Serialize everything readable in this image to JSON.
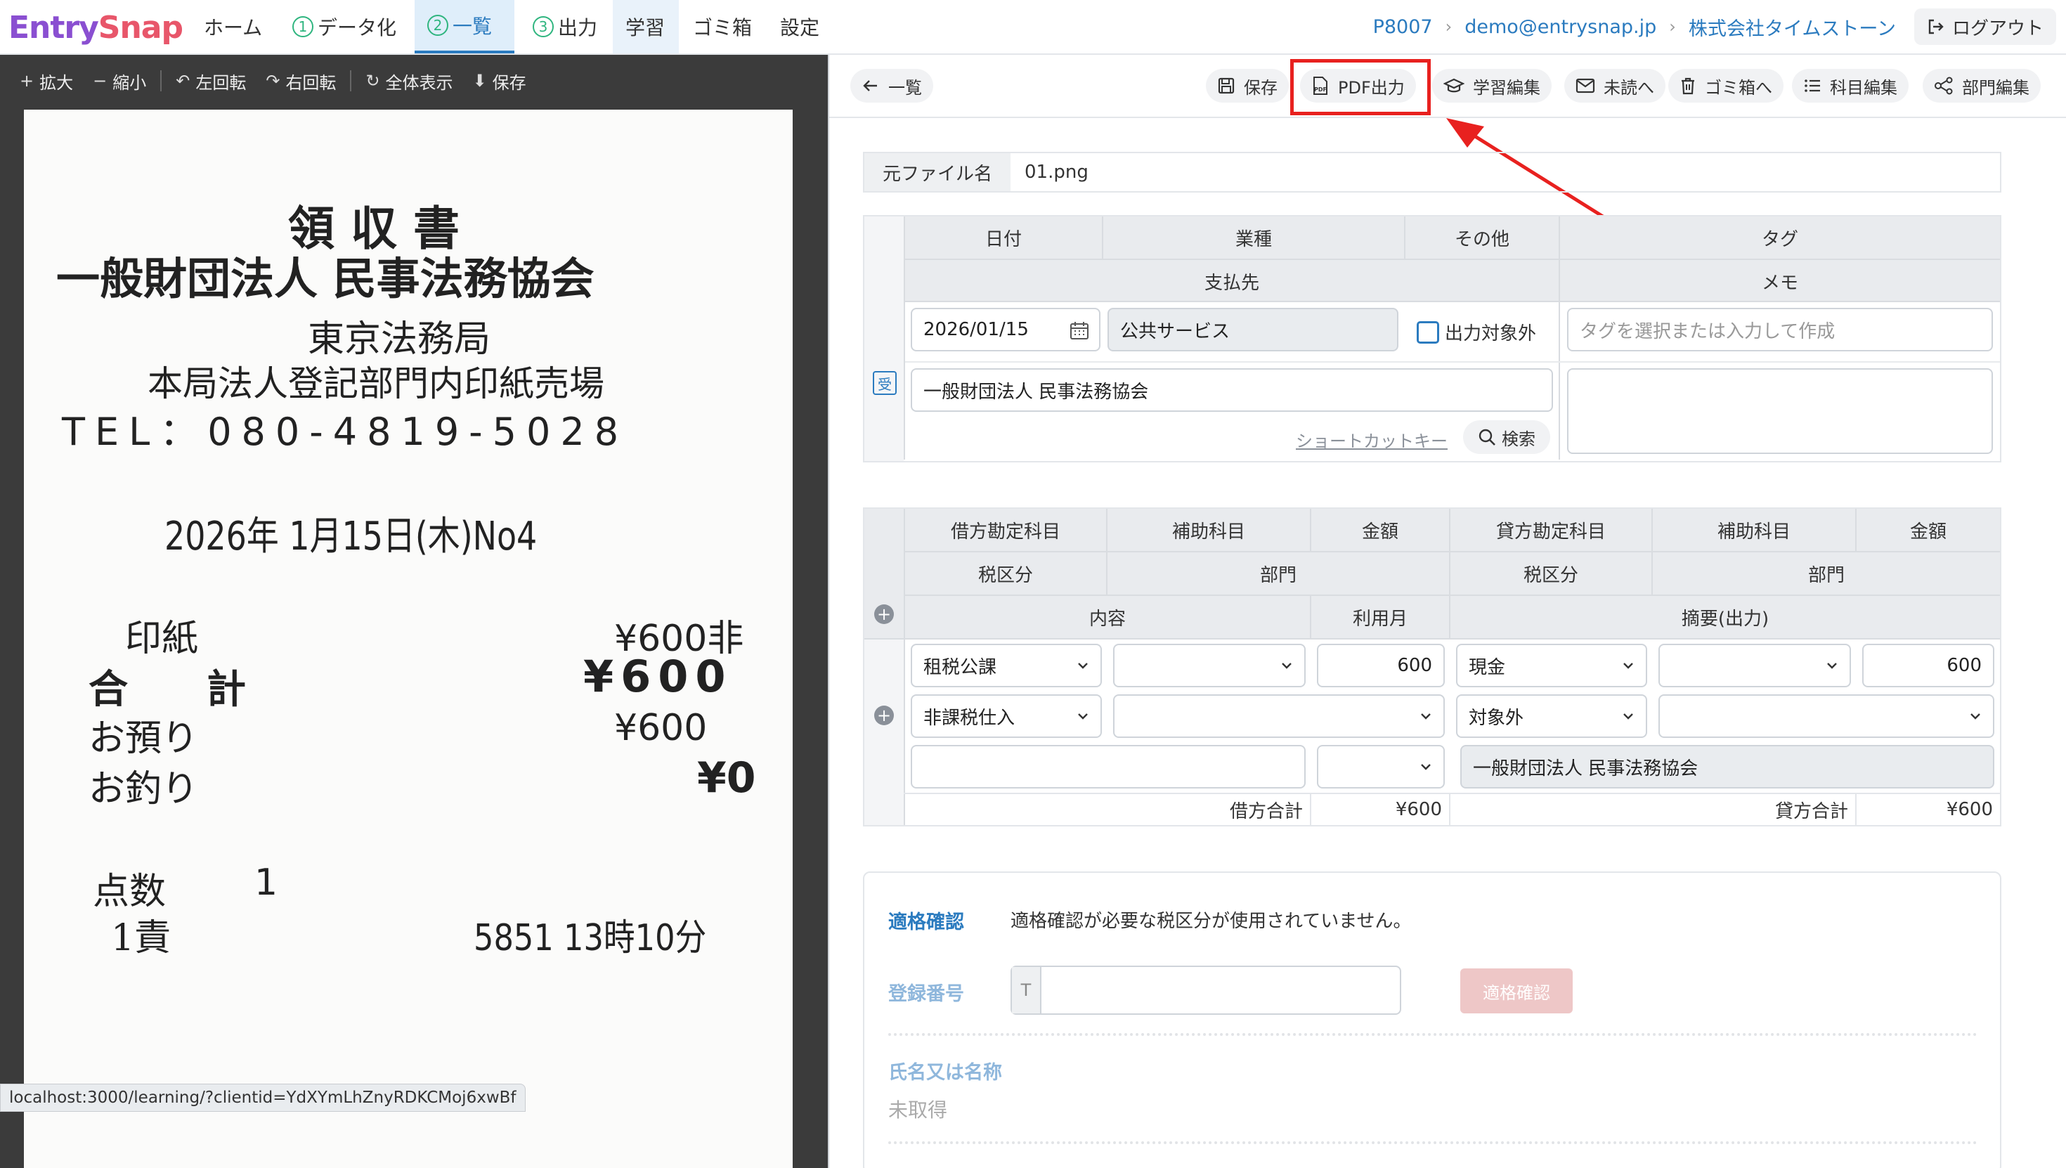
{
  "brand": {
    "part1": "Entry",
    "part2": "Snap"
  },
  "nav": {
    "home": "ホーム",
    "step1_num": "1",
    "step1": "データ化",
    "step2_num": "2",
    "step2": "一覧",
    "step3_num": "3",
    "step3": "出力",
    "learning": "学習",
    "trash": "ゴミ箱",
    "settings": "設定"
  },
  "breadcrumb": {
    "client": "P8007",
    "email": "demo@entrysnap.jp",
    "company": "株式会社タイムストーン",
    "logout": "ログアウト"
  },
  "viewer_toolbar": {
    "zoom_in": "拡大",
    "zoom_out": "縮小",
    "rotate_left": "左回転",
    "rotate_right": "右回転",
    "fit": "全体表示",
    "save": "保存"
  },
  "receipt": {
    "title": "領 収 書",
    "issuer": "一般財団法人 民事法務協会",
    "office": "東京法務局",
    "counter": "本局法人登記部門内印紙売場",
    "tel": "TEL：080-4819-5028",
    "date": "2026年 1月15日(木)No4",
    "item": "印紙",
    "item_amount": "¥600非",
    "total_label": "合　　計",
    "total": "¥600",
    "paid_label": "お預り",
    "paid": "¥600",
    "change_label": "お釣り",
    "change": "¥0",
    "count_label": "点数",
    "count": "1",
    "staff": "1責",
    "footer": "5851 13時10分"
  },
  "status_url": "localhost:3000/learning/?clientid=YdXYmLhZnyRDKCMoj6xwBf",
  "right_toolbar": {
    "back": "一覧",
    "save": "保存",
    "pdf": "PDF出力",
    "learn_edit": "学習編集",
    "unread": "未読へ",
    "to_trash": "ゴミ箱へ",
    "account_edit": "科目編集",
    "dept_edit": "部門編集"
  },
  "file": {
    "label": "元ファイル名",
    "value": "01.png"
  },
  "header_table": {
    "date_h": "日付",
    "industry_h": "業種",
    "other_h": "その他",
    "tag_h": "タグ",
    "payee_h": "支払先",
    "memo_h": "メモ",
    "date": "2026/01/15",
    "industry": "公共サービス",
    "exclude_label": "出力対象外",
    "tag_placeholder": "タグを選択または入力して作成",
    "badge": "受",
    "payee": "一般財団法人 民事法務協会",
    "shortcut": "ショートカットキー",
    "search": "検索"
  },
  "journal": {
    "debit_account_h": "借方勘定科目",
    "debit_sub_h": "補助科目",
    "debit_amount_h": "金額",
    "credit_account_h": "貸方勘定科目",
    "credit_sub_h": "補助科目",
    "credit_amount_h": "金額",
    "debit_tax_h": "税区分",
    "debit_dept_h": "部門",
    "credit_tax_h": "税区分",
    "credit_dept_h": "部門",
    "content_h": "内容",
    "month_h": "利用月",
    "summary_h": "摘要(出力)",
    "debit_account": "租税公課",
    "debit_amount": "600",
    "credit_account": "現金",
    "credit_amount": "600",
    "debit_tax": "非課税仕入",
    "credit_tax": "対象外",
    "summary": "一般財団法人 民事法務協会",
    "debit_total_label": "借方合計",
    "debit_total": "¥600",
    "credit_total_label": "貸方合計",
    "credit_total": "¥600"
  },
  "qualify": {
    "title": "適格確認",
    "message": "適格確認が必要な税区分が使用されていません。",
    "reg_label": "登録番号",
    "reg_prefix": "T",
    "reg_button": "適格確認",
    "name_label": "氏名又は名称",
    "name_value": "未取得"
  },
  "colors": {
    "accent": "#2b7bbf",
    "highlight": "#e8211f",
    "brand_purple": "#8a4fd1",
    "brand_red": "#e8566a"
  }
}
